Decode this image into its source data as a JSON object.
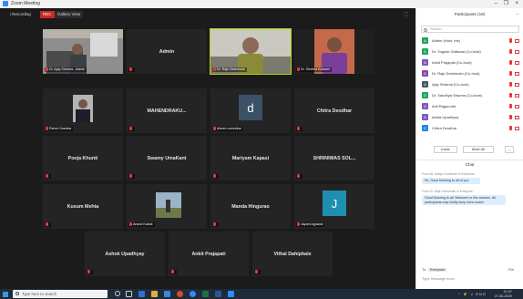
{
  "window": {
    "title": "Zoom Meeting"
  },
  "topbar": {
    "info": "i  Recording",
    "rec": "REC",
    "view": "Gallery View",
    "fullscreen": "⛶"
  },
  "tiles": [
    {
      "name": "",
      "footer": "Dr. Ajay Sharma - Admin",
      "type": "video"
    },
    {
      "name": "Admin",
      "footer": "",
      "type": "name"
    },
    {
      "name": "",
      "footer": "Dr. Raje Deshmukh",
      "type": "video"
    },
    {
      "name": "",
      "footer": "Dr. Shobha Kulkarni",
      "type": "video"
    },
    {
      "name": "",
      "footer": "Rahul Chandra",
      "type": "video"
    },
    {
      "name": "MAHENDRAKU...",
      "footer": "",
      "type": "name"
    },
    {
      "name": "",
      "footer": "dinesh umredkar",
      "type": "avatar",
      "letter": "d"
    },
    {
      "name": "Chitra Deodhar",
      "footer": "",
      "type": "name"
    },
    {
      "name": "Pooja Khunti",
      "footer": "",
      "type": "name"
    },
    {
      "name": "Swamy UmaKant",
      "footer": "",
      "type": "name"
    },
    {
      "name": "Mariyam Kapasi",
      "footer": "",
      "type": "name"
    },
    {
      "name": "SHRINIWAS SOL...",
      "footer": "",
      "type": "name"
    },
    {
      "name": "Kusum Mehta",
      "footer": "",
      "type": "name"
    },
    {
      "name": "",
      "footer": "Anand Kakde",
      "type": "video"
    },
    {
      "name": "Manda Hingurao",
      "footer": "",
      "type": "name"
    },
    {
      "name": "",
      "footer": "Jayant Agrawal",
      "type": "avatar",
      "letter": "J"
    },
    {
      "name": "Ashok Upadhyay",
      "footer": "",
      "type": "name"
    },
    {
      "name": "Ankit Prajapati",
      "footer": "",
      "type": "name"
    },
    {
      "name": "Vithal Dahiphale",
      "footer": "",
      "type": "name"
    }
  ],
  "panel": {
    "title": "Participants (18)",
    "search_placeholder": "Search",
    "participants": [
      {
        "name": "Admin (Host, me)",
        "initial": "A",
        "color": "#23a25a"
      },
      {
        "name": "Dr. Yogesh Gaikwad (Co-host)",
        "initial": "D",
        "color": "#23a25a"
      },
      {
        "name": "Ankit Prajapati (Co-host)",
        "initial": "A",
        "color": "#7e57c2"
      },
      {
        "name": "Dr. Raje Deshmukh (Co-host)",
        "initial": "D",
        "color": "#8e44ad"
      },
      {
        "name": "Ajay Sharma (Co-host)",
        "initial": "A",
        "color": "#455a64"
      },
      {
        "name": "Dr. Sandhya Sharma (Co-host)",
        "initial": "D",
        "color": "#23a25a"
      },
      {
        "name": "Anil Rajpurohit",
        "initial": "A",
        "color": "#7e57c2"
      },
      {
        "name": "Amita Upadhyay",
        "initial": "A",
        "color": "#7e57c2"
      },
      {
        "name": "Chitra Deodhar",
        "initial": "C",
        "color": "#1e88e5"
      }
    ],
    "invite": "Invite",
    "mute_all": "Mute All",
    "more": "...",
    "chat_title": "Chat",
    "messages": [
      {
        "meta": "From Mr. Aditya Fumbhare to Everyone:",
        "text": "Sir, Good Morning to all of you."
      },
      {
        "meta": "From Dr. Raje Deshmukh to Everyone:",
        "text": "Good Morning to all. Welcome to this session. All participants may kindly keep mics muted."
      }
    ],
    "to_label": "To:",
    "to_value": "Everyone",
    "file_label": "File",
    "input_placeholder": "Type message here..."
  },
  "taskbar": {
    "search_placeholder": "Type here to search",
    "time": "10:47",
    "date": "27-06-2020",
    "tray_icons": "^ ⚡ ♫ ENG"
  }
}
